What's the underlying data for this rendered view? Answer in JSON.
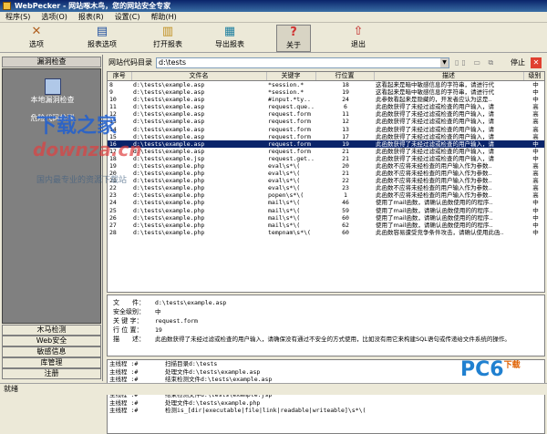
{
  "window": {
    "title": "WebPecker - 网站啄木鸟，您的网站安全专家"
  },
  "menu": [
    "程序(S)",
    "选项(O)",
    "报表(R)",
    "设置(C)",
    "帮助(H)"
  ],
  "toolbar": [
    {
      "label": "选项",
      "icon": "cross-icon"
    },
    {
      "label": "报表选项",
      "icon": "report-options-icon"
    },
    {
      "label": "打开报表",
      "icon": "open-report-icon"
    },
    {
      "label": "导出报表",
      "icon": "export-report-icon"
    },
    {
      "label": "关于",
      "icon": "question-icon"
    },
    {
      "label": "退出",
      "icon": "exit-icon"
    }
  ],
  "sidebar": {
    "header": "漏洞检查",
    "items": [
      "本地漏洞检查",
      "危险代码检测"
    ],
    "buttons": [
      "木马检测",
      "Web安全",
      "敏感信息",
      "库管理",
      "注册"
    ]
  },
  "dirbar": {
    "label": "网站代码目录",
    "value": "d:\\tests",
    "stop_label": "停止"
  },
  "table": {
    "columns": [
      "序号",
      "文件名",
      "关键字",
      "行位置",
      "描述",
      "级别"
    ],
    "rows": [
      [
        "8",
        "d:\\tests\\example.asp",
        "*session.*",
        "18",
        "这看起来是暗中敏感信息的字符串，请进行代",
        "中"
      ],
      [
        "9",
        "d:\\tests\\example.asp",
        "*session.*",
        "19",
        "这看起来是暗中敏感信息的字符串，请进行代",
        "中"
      ],
      [
        "10",
        "d:\\tests\\example.asp",
        "#input.*ty..",
        "24",
        "此参数看起来是隐藏的，开发者应认为这是..",
        "中"
      ],
      [
        "11",
        "d:\\tests\\example.asp",
        "request.que..",
        "6",
        "此函数获得了未经过滤或检查的用户输入，请",
        "高"
      ],
      [
        "12",
        "d:\\tests\\example.asp",
        "request.form",
        "11",
        "此函数获得了未经过滤或检查的用户输入，请",
        "高"
      ],
      [
        "13",
        "d:\\tests\\example.asp",
        "request.form",
        "12",
        "此函数获得了未经过滤或检查的用户输入，请",
        "高"
      ],
      [
        "14",
        "d:\\tests\\example.asp",
        "request.form",
        "13",
        "此函数获得了未经过滤或检查的用户输入，请",
        "高"
      ],
      [
        "15",
        "d:\\tests\\example.asp",
        "request.form",
        "17",
        "此函数获得了未经过滤或检查的用户输入，请",
        "高"
      ],
      [
        "16",
        "d:\\tests\\example.asp",
        "request.form",
        "19",
        "此函数获得了未经过滤或检查的用户输入，请",
        "中"
      ],
      [
        "17",
        "d:\\tests\\example.asp",
        "request.form",
        "21",
        "此函数获得了未经过滤或检查的用户输入，请",
        "中"
      ],
      [
        "18",
        "d:\\tests\\example.jsp",
        "request.get..",
        "21",
        "此函数获得了未经过滤或检查的用户输入，请",
        "中"
      ],
      [
        "19",
        "d:\\tests\\example.php",
        "eval\\s*\\(",
        "20",
        "此函数不应将未经检查的用户输入作为参数..",
        "高"
      ],
      [
        "20",
        "d:\\tests\\example.php",
        "eval\\s*\\(",
        "21",
        "此函数不应将未经检查的用户输入作为参数..",
        "高"
      ],
      [
        "21",
        "d:\\tests\\example.php",
        "eval\\s*\\(",
        "22",
        "此函数不应将未经检查的用户输入作为参数..",
        "高"
      ],
      [
        "22",
        "d:\\tests\\example.php",
        "eval\\s*\\(",
        "23",
        "此函数不应将未经检查的用户输入作为参数..",
        "高"
      ],
      [
        "23",
        "d:\\tests\\example.php",
        "popen\\s*\\(",
        "1",
        "此函数不应将未经检查的用户输入作为参数..",
        "高"
      ],
      [
        "24",
        "d:\\tests\\example.php",
        "mail\\s*\\(",
        "46",
        "使用了mail函数，请确认函数使用的的程序..",
        "中"
      ],
      [
        "25",
        "d:\\tests\\example.php",
        "mail\\s*\\(",
        "59",
        "使用了mail函数，请确认函数使用的的程序..",
        "中"
      ],
      [
        "26",
        "d:\\tests\\example.php",
        "mail\\s*\\(",
        "60",
        "使用了mail函数，请确认函数使用的的程序..",
        "中"
      ],
      [
        "27",
        "d:\\tests\\example.php",
        "mail\\s*\\(",
        "62",
        "使用了mail函数，请确认函数使用的的程序..",
        "中"
      ],
      [
        "28",
        "d:\\tests\\example.php",
        "tempnam\\s*\\(",
        "60",
        "此函数容易遭受竞争条件攻击，请确认使用此函..",
        "中"
      ]
    ],
    "selected_row": 8
  },
  "detail": {
    "file_label": "文　　件：",
    "file_value": "d:\\tests\\example.asp",
    "level_label": "安全级别：",
    "level_value": "中",
    "keyword_label": "关 键 字：",
    "keyword_value": "request.form",
    "line_label": "行 位 置：",
    "line_value": "19",
    "desc_label": "描　　述：",
    "desc_value": "此函数获得了未经过滤或检查的用户输入，请确保没有通过不安全的方式使用，比如没有用它来构建SQL语句或传递给文件系统的操作。"
  },
  "log": [
    [
      "主线程 :#",
      "扫描目录d:\\tests"
    ],
    [
      "主线程 :#",
      "处理文件d:\\tests\\example.asp"
    ],
    [
      "主线程 :#",
      "结束检测文件d:\\tests\\example.asp"
    ],
    [
      "主线程 :#",
      "处理文件d:\\tests\\example.jsp"
    ],
    [
      "主线程 :#",
      "结束检测文件d:\\tests\\example.jsp"
    ],
    [
      "主线程 :#",
      "处理文件d:\\tests\\example.php"
    ],
    [
      "主线程 :#",
      "检测is_[dir|executable|file|link|readable|writeable]\\s*\\("
    ]
  ],
  "status": "就绪",
  "watermarks": [
    "下载之家",
    "downza.cn",
    "国内最专业的资源下载站",
    "PC6",
    "下载"
  ]
}
